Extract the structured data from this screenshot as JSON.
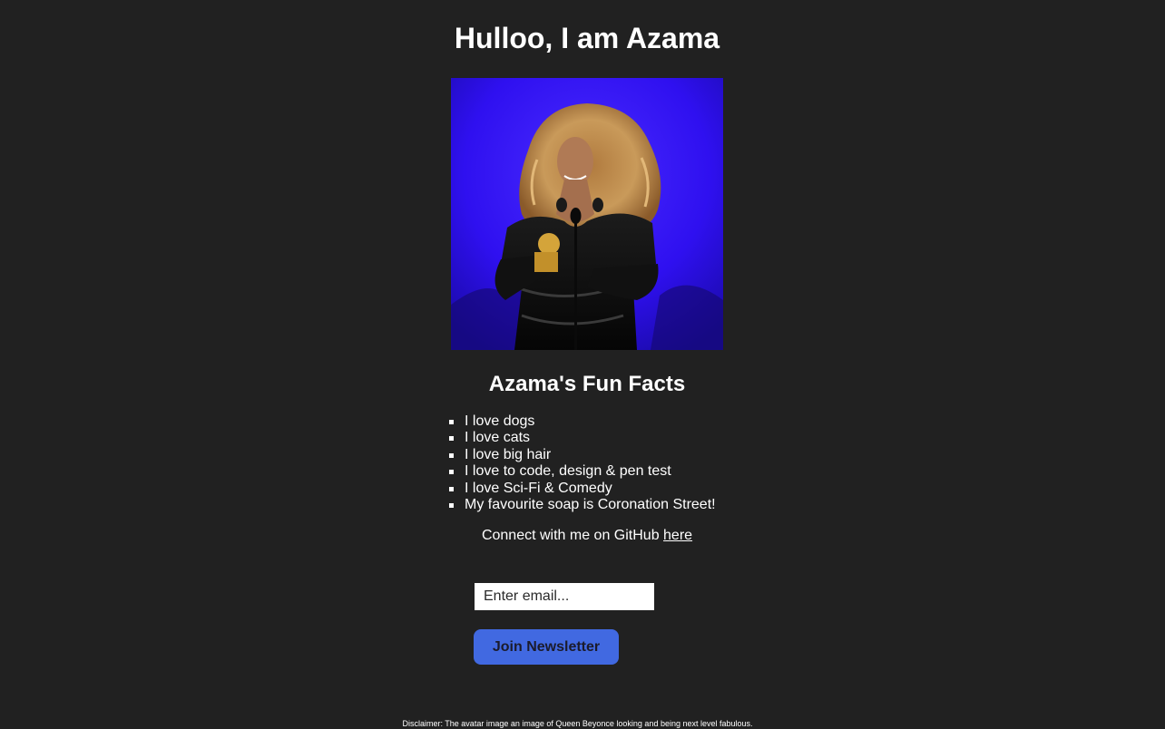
{
  "header": {
    "title": "Hulloo, I am Azama"
  },
  "avatar": {
    "alt": "Queen Beyonce holding a Grammy award on stage"
  },
  "fun_facts": {
    "title": "Azama's Fun Facts",
    "items": [
      "I love dogs",
      "I love cats",
      "I love big hair",
      "I love to code, design & pen test",
      "I love Sci-Fi & Comedy",
      "My favourite soap is Coronation Street!"
    ]
  },
  "github": {
    "text": "Connect with me on GitHub ",
    "link_label": "here"
  },
  "newsletter": {
    "email_placeholder": "Enter email...",
    "email_value": "",
    "button_label": "Join Newsletter"
  },
  "footer": {
    "disclaimer": "Disclaimer: The avatar image an image of Queen Beyonce looking and being next level fabulous."
  },
  "colors": {
    "background": "#212121",
    "text": "#ffffff",
    "button": "#4169e1",
    "avatar_backdrop": "#2f10f0"
  },
  "icons": {
    "list_bullet": "square-bullet-icon"
  }
}
